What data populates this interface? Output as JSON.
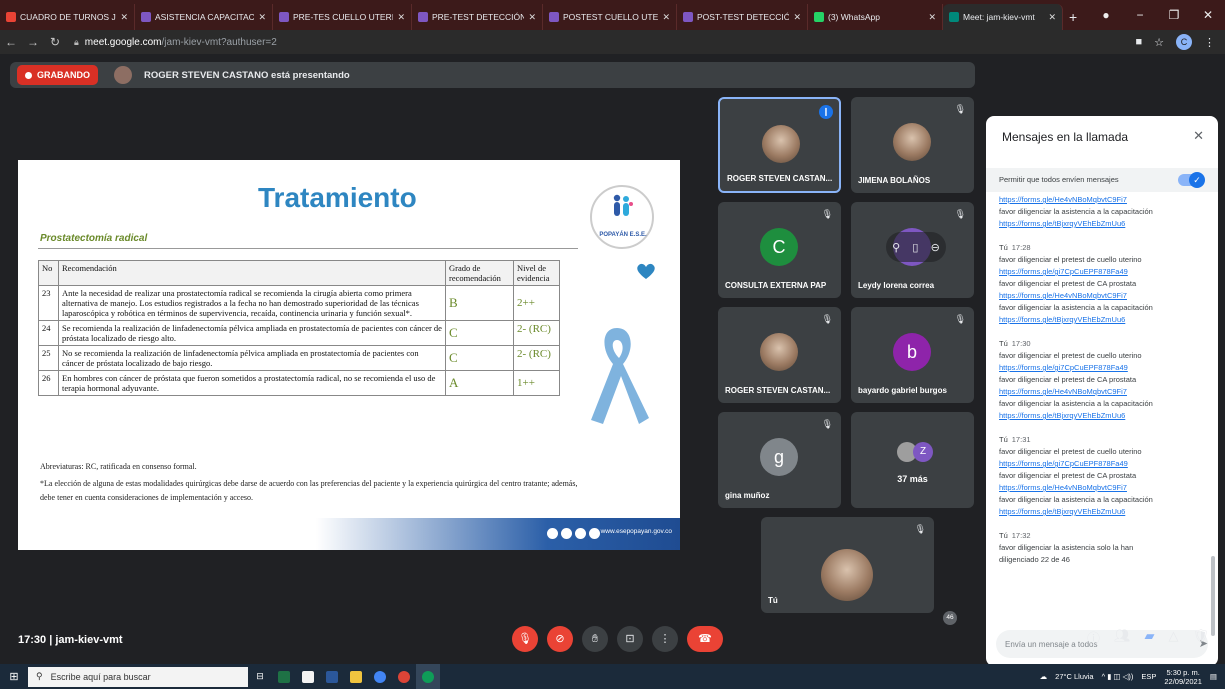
{
  "browser": {
    "tabs": [
      {
        "title": "CUADRO DE TURNOS JULI",
        "color": "#ea4335"
      },
      {
        "title": "ASISTENCIA CAPACITACIO",
        "color": "#7e57c2"
      },
      {
        "title": "PRE-TES CUELLO UTERINO",
        "color": "#7e57c2"
      },
      {
        "title": "PRE-TEST DETECCIÓN TEM",
        "color": "#7e57c2"
      },
      {
        "title": "POSTEST CUELLO UTERINO",
        "color": "#7e57c2"
      },
      {
        "title": "POST-TEST DETECCIÓN TE",
        "color": "#7e57c2"
      },
      {
        "title": "(3) WhatsApp",
        "color": "#25d366"
      },
      {
        "title": "Meet: jam-kiev-vmt",
        "color": "#00897b"
      }
    ],
    "url_host": "meet.google.com",
    "url_path": "/jam-kiev-vmt?authuser=2",
    "profile_initial": "C"
  },
  "recording": {
    "label": "GRABANDO",
    "presenter_text": "ROGER STEVEN CASTANO está presentando"
  },
  "slide": {
    "title": "Tratamiento",
    "subtitle": "Prostatectomía radical",
    "logo_name": "POPAYÁN E.S.E.",
    "headers": {
      "no": "No",
      "rec": "Recomendación",
      "grade": "Grado de recomendación",
      "level": "Nivel de evidencia"
    },
    "rows": [
      {
        "no": "23",
        "text": "Ante la necesidad de realizar una prostatectomía radical se recomienda la cirugía abierta como primera alternativa de manejo. Los estudios registrados a la fecha no han demostrado superioridad de las técnicas laparoscópica y robótica en términos de supervivencia, recaída, continencia urinaria y función sexual*.",
        "grade": "B",
        "level": "2++"
      },
      {
        "no": "24",
        "text": "Se recomienda la realización de linfadenectomía pélvica ampliada en prostatectomía de pacientes con cáncer de próstata localizado de riesgo alto.",
        "grade": "C",
        "level": "2- (RC)"
      },
      {
        "no": "25",
        "text": "No se recomienda la realización de linfadenectomía pélvica ampliada en prostatectomía de pacientes con cáncer de próstata localizado de bajo riesgo.",
        "grade": "C",
        "level": "2- (RC)"
      },
      {
        "no": "26",
        "text": "En hombres con cáncer de próstata que fueron sometidos a prostatectomía radical, no se recomienda el uso de terapia hormonal adyuvante.",
        "grade": "A",
        "level": "1++"
      }
    ],
    "abbreviations": "Abreviaturas: RC, ratificada en consenso formal.",
    "footnote": "*La elección de alguna de estas modalidades quirúrgicas debe darse de acuerdo con las preferencias del paciente y la experiencia quirúrgica del centro tratante; además, debe tener en cuenta consideraciones de implementación y acceso.",
    "website": "www.esepopayan.gov.co"
  },
  "tiles": [
    {
      "name": "ROGER STEVEN CASTAN...",
      "initial": "",
      "color": "",
      "photo": true,
      "active": true
    },
    {
      "name": "JIMENA BOLAÑOS",
      "initial": "",
      "color": "",
      "photo": true
    },
    {
      "name": "CONSULTA EXTERNA PAP",
      "initial": "C",
      "color": "#1e8e3e"
    },
    {
      "name": "Leydy lorena correa",
      "initial": "",
      "color": "#7e57c2"
    },
    {
      "name": "ROGER STEVEN CASTAN...",
      "initial": "",
      "color": "",
      "photo": true
    },
    {
      "name": "bayardo gabriel burgos",
      "initial": "b",
      "color": "#8e24aa"
    },
    {
      "name": "gina muñoz",
      "initial": "g",
      "color": "#80868b"
    },
    {
      "name": "37 más",
      "initial": "Z",
      "color": "#7e57c2"
    },
    {
      "name": "Tú",
      "initial": "",
      "color": "",
      "photo": true
    }
  ],
  "chat": {
    "title": "Mensajes en la llamada",
    "allow_label": "Permitir que todos envíen mensajes",
    "placeholder": "Envía un mensaje a todos",
    "top_lines": [
      {
        "text": "https://forms.gle/He4vNBoMqbvtC9Fi7",
        "link": true
      },
      {
        "text": "favor diligenciar la asistencia a la capacitación",
        "link": false
      },
      {
        "text": "https://forms.gle/tBjxrqyVEhEbZmUu6",
        "link": true
      }
    ],
    "messages": [
      {
        "sender": "Tú",
        "time": "17:28",
        "lines": [
          {
            "text": "favor diligenciar el pretest de cuello uterino",
            "link": false
          },
          {
            "text": "https://forms.gle/gi7CpCuEPF878Fa49",
            "link": true
          },
          {
            "text": "favor diligenciar el pretest de CA prostata",
            "link": false
          },
          {
            "text": "https://forms.gle/He4vNBoMqbvtC9Fi7",
            "link": true
          },
          {
            "text": "favor diligenciar la asistencia a la capacitación",
            "link": false
          },
          {
            "text": "https://forms.gle/tBjxrqyVEhEbZmUu6",
            "link": true
          }
        ]
      },
      {
        "sender": "Tú",
        "time": "17:30",
        "lines": [
          {
            "text": "favor diligenciar el pretest de cuello uterino",
            "link": false
          },
          {
            "text": "https://forms.gle/gi7CpCuEPF878Fa49",
            "link": true
          },
          {
            "text": "favor diligenciar el pretest de CA prostata",
            "link": false
          },
          {
            "text": "https://forms.gle/He4vNBoMqbvtC9Fi7",
            "link": true
          },
          {
            "text": "favor diligenciar la asistencia a la capacitación",
            "link": false
          },
          {
            "text": "https://forms.gle/tBjxrqyVEhEbZmUu6",
            "link": true
          }
        ]
      },
      {
        "sender": "Tú",
        "time": "17:31",
        "lines": [
          {
            "text": "favor diligenciar el pretest de cuello uterino",
            "link": false
          },
          {
            "text": "https://forms.gle/gi7CpCuEPF878Fa49",
            "link": true
          },
          {
            "text": "favor diligenciar el pretest de CA prostata",
            "link": false
          },
          {
            "text": "https://forms.gle/He4vNBoMqbvtC9Fi7",
            "link": true
          },
          {
            "text": "favor diligenciar la asistencia a la capacitación",
            "link": false
          },
          {
            "text": "https://forms.gle/tBjxrqyVEhEbZmUu6",
            "link": true
          }
        ]
      },
      {
        "sender": "Tú",
        "time": "17:32",
        "lines": [
          {
            "text": "favor diligenciar la asistencia solo la han",
            "link": false
          },
          {
            "text": "diligenciado 22 de 46",
            "link": false
          }
        ]
      }
    ]
  },
  "meeting": {
    "info": "17:30  |  jam-kiev-vmt",
    "people_count": "46"
  },
  "taskbar": {
    "search_placeholder": "Escribe aquí para buscar",
    "weather": "27°C  Lluvia",
    "lang": "ESP",
    "time": "5:30 p. m.",
    "date": "22/09/2021"
  }
}
